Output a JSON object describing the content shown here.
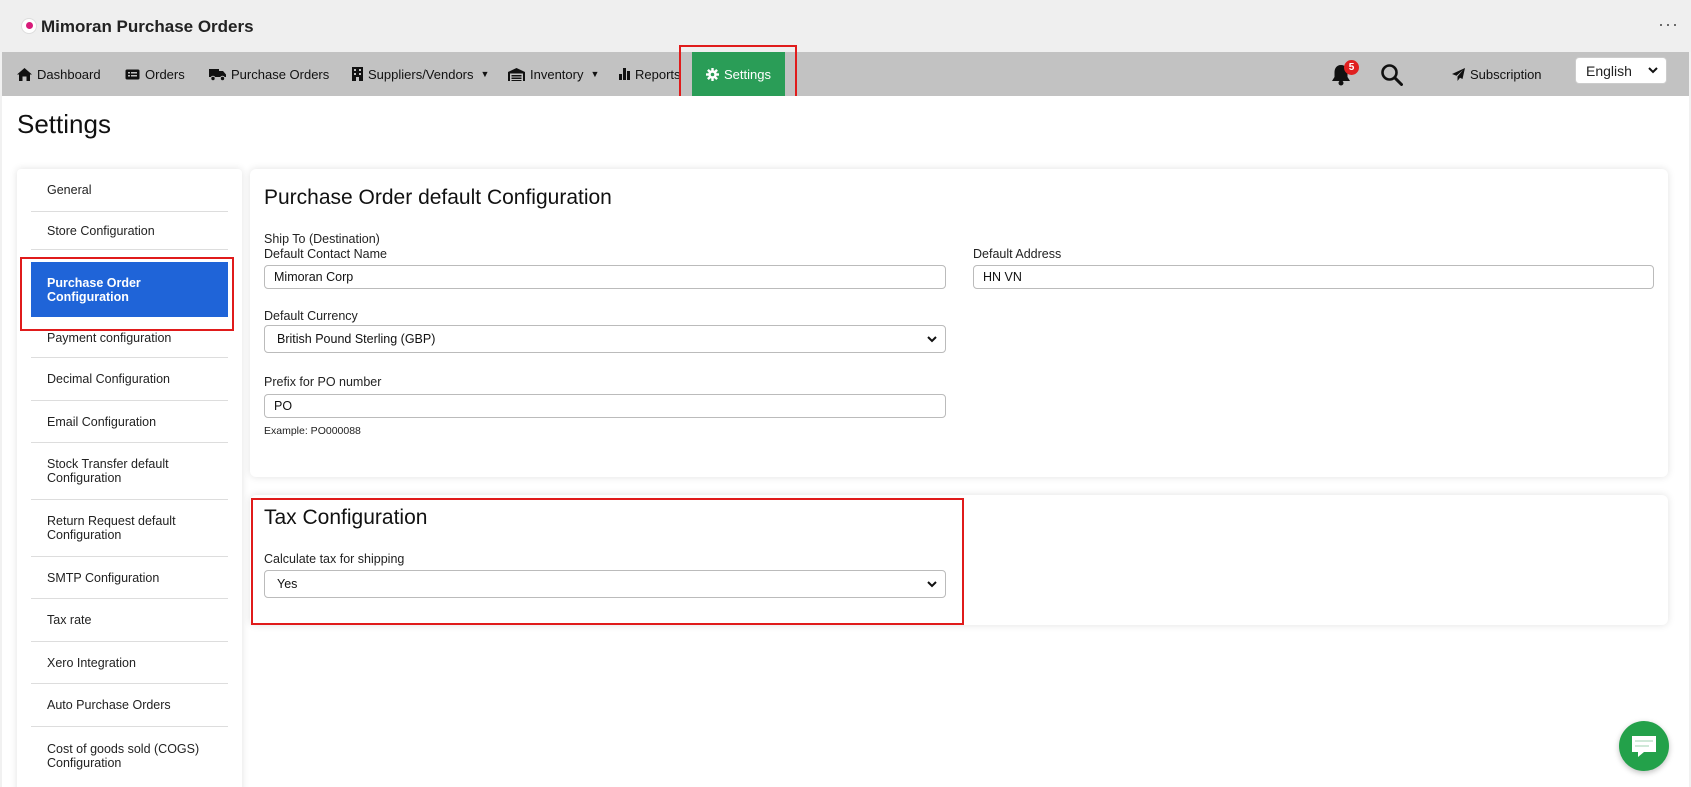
{
  "app": {
    "title": "Mimoran Purchase Orders",
    "more": "···"
  },
  "nav": {
    "items": [
      {
        "label": "Dashboard"
      },
      {
        "label": "Orders"
      },
      {
        "label": "Purchase Orders"
      },
      {
        "label": "Suppliers/Vendors"
      },
      {
        "label": "Inventory"
      },
      {
        "label": "Reports"
      },
      {
        "label": "Settings"
      }
    ],
    "notification_count": "5",
    "subscription": "Subscription",
    "language": "English"
  },
  "page": {
    "title": "Settings"
  },
  "sidebar": {
    "items": [
      {
        "label": "General"
      },
      {
        "label": "Store Configuration"
      },
      {
        "label": "Purchase Order Configuration"
      },
      {
        "label": "Payment configuration"
      },
      {
        "label": "Decimal Configuration"
      },
      {
        "label": "Email Configuration"
      },
      {
        "label": "Stock Transfer default Configuration"
      },
      {
        "label": "Return Request default Configuration"
      },
      {
        "label": "SMTP Configuration"
      },
      {
        "label": "Tax rate"
      },
      {
        "label": "Xero Integration"
      },
      {
        "label": "Auto Purchase Orders"
      },
      {
        "label": "Cost of goods sold (COGS) Configuration"
      }
    ],
    "active": "Purchase Order Configuration"
  },
  "po_config": {
    "title": "Purchase Order default Configuration",
    "ship_to_label": "Ship To (Destination)",
    "contact_name_label": "Default Contact Name",
    "contact_name_value": "Mimoran Corp",
    "address_label": "Default Address",
    "address_value": "HN VN",
    "currency_label": "Default Currency",
    "currency_value": "British Pound Sterling (GBP)",
    "prefix_label": "Prefix for PO number",
    "prefix_value": "PO",
    "prefix_example": "Example: PO000088"
  },
  "tax_config": {
    "title": "Tax Configuration",
    "shipping_tax_label": "Calculate tax for shipping",
    "shipping_tax_value": "Yes"
  },
  "colors": {
    "nav_bg": "#c2c2c2",
    "settings_active": "#2a9d57",
    "sidebar_active": "#1f64d8",
    "highlight_box": "#e01b1b",
    "chat_button": "#23a14a"
  }
}
